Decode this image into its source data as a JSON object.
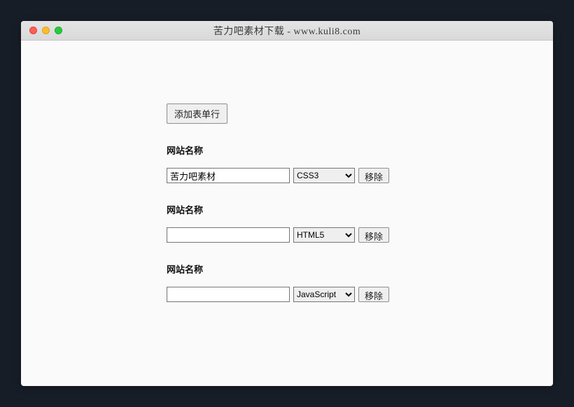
{
  "window": {
    "title": "苦力吧素材下载 - www.kuli8.com"
  },
  "form": {
    "addButtonLabel": "添加表单行",
    "fieldLabel": "网站名称",
    "removeButtonLabel": "移除",
    "selectOptions": [
      "CSS3",
      "HTML5",
      "JavaScript"
    ],
    "rows": [
      {
        "textValue": "苦力吧素材",
        "selectValue": "CSS3"
      },
      {
        "textValue": "",
        "selectValue": "HTML5"
      },
      {
        "textValue": "",
        "selectValue": "JavaScript"
      }
    ]
  }
}
